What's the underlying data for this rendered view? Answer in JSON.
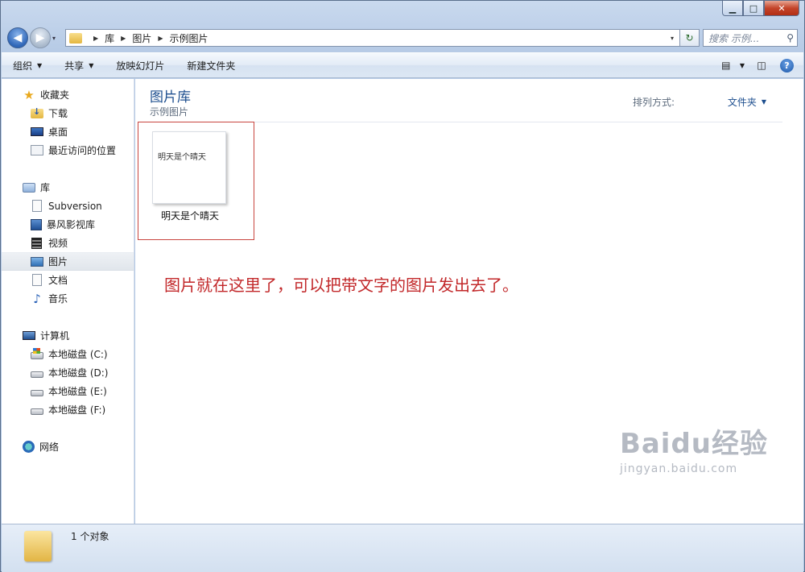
{
  "window": {
    "controls": {
      "minimize": "▁",
      "maximize": "□",
      "close": "✕"
    }
  },
  "address": {
    "back_icon": "◀",
    "forward_icon": "▶",
    "history_caret": "▾",
    "crumbs": [
      "库",
      "图片",
      "示例图片"
    ],
    "crumb_sep": "▶",
    "dropdown": "▾",
    "refresh_icon": "↻"
  },
  "search": {
    "placeholder": "搜索 示例...",
    "icon": "⚲"
  },
  "toolbar": {
    "organize": "组织",
    "share": "共享",
    "slideshow": "放映幻灯片",
    "new_folder": "新建文件夹",
    "caret": "▼",
    "view_icon": "▤",
    "pane_icon": "◫",
    "help": "?"
  },
  "sidebar": {
    "favorites": {
      "label": "收藏夹",
      "items": [
        "下载",
        "桌面",
        "最近访问的位置"
      ]
    },
    "libraries": {
      "label": "库",
      "items": [
        "Subversion",
        "暴风影视库",
        "视频",
        "图片",
        "文档",
        "音乐"
      ],
      "selected": "图片"
    },
    "computer": {
      "label": "计算机",
      "items": [
        "本地磁盘 (C:)",
        "本地磁盘 (D:)",
        "本地磁盘 (E:)",
        "本地磁盘 (F:)"
      ]
    },
    "network": {
      "label": "网络"
    }
  },
  "content": {
    "title": "图片库",
    "subtitle": "示例图片",
    "sort_label": "排列方式:",
    "sort_value": "文件夹",
    "file": {
      "name": "明天是个晴天",
      "thumbnail_text": "明天是个晴天"
    },
    "annotation": "图片就在这里了，可以把带文字的图片发出去了。"
  },
  "watermark": {
    "logo": "Baidu经验",
    "url": "jingyan.baidu.com"
  },
  "status": {
    "text": "1 个对象"
  },
  "colors": {
    "accent": "#1e4f8f",
    "annotation": "#c2282a",
    "highlight_border": "#c8453f"
  }
}
